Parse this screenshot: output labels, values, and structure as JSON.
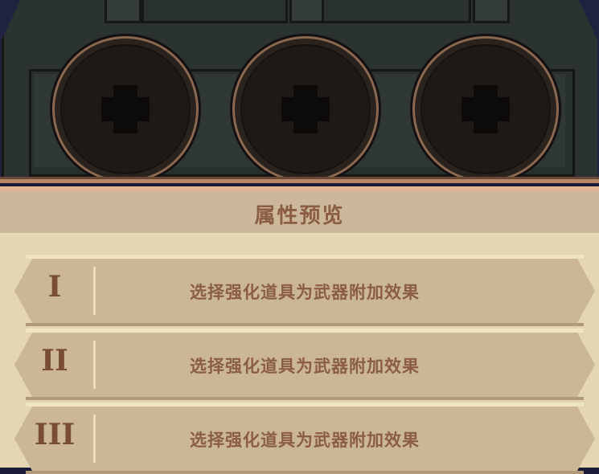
{
  "slots": [
    {
      "icon": "plus-icon"
    },
    {
      "icon": "plus-icon"
    },
    {
      "icon": "plus-icon"
    }
  ],
  "preview": {
    "title": "属性预览",
    "rows": [
      {
        "numeral": "I",
        "text": "选择强化道具为武器附加效果"
      },
      {
        "numeral": "II",
        "text": "选择强化道具为武器附加效果"
      },
      {
        "numeral": "III",
        "text": "选择强化道具为武器附加效果"
      }
    ]
  }
}
